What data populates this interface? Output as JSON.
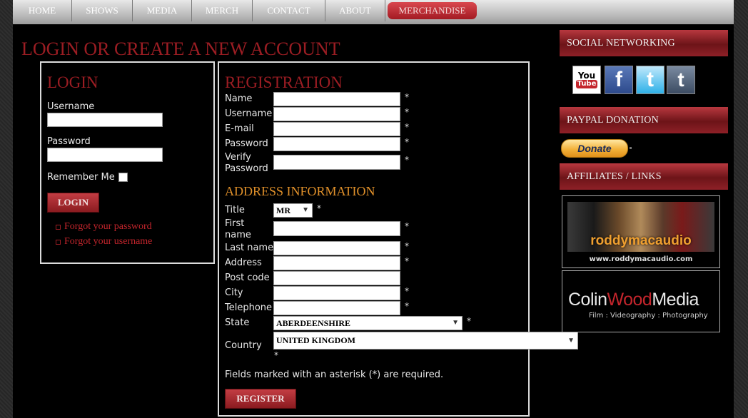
{
  "nav": {
    "items": [
      "HOME",
      "SHOWS",
      "MEDIA",
      "MERCH",
      "CONTACT",
      "ABOUT"
    ],
    "active": "MERCHANDISE"
  },
  "page_title": "LOGIN OR CREATE A NEW ACCOUNT",
  "login": {
    "heading": "LOGIN",
    "username_label": "Username",
    "password_label": "Password",
    "remember_label": "Remember Me",
    "button": "LOGIN",
    "forgot_password": "Forgot your password",
    "forgot_username": "Forgot your username"
  },
  "registration": {
    "heading": "REGISTRATION",
    "name_label": "Name",
    "username_label": "Username",
    "email_label": "E-mail",
    "password_label": "Password",
    "verify_label_1": "Verify",
    "verify_label_2": "Password",
    "required_mark": "*"
  },
  "address": {
    "heading": "ADDRESS INFORMATION",
    "title_label": "Title",
    "title_value": "MR",
    "first_name_label_1": "First",
    "first_name_label_2": "name",
    "last_name_label": "Last name",
    "address_label": "Address",
    "postcode_label": "Post code",
    "city_label": "City",
    "telephone_label": "Telephone",
    "state_label": "State",
    "state_value": "ABERDEENSHIRE",
    "country_label": "Country",
    "country_value": "UNITED KINGDOM",
    "required_note": "Fields marked with an asterisk (*) are required.",
    "register_button": "REGISTER"
  },
  "sidebar": {
    "social_heading": "SOCIAL NETWORKING",
    "social_icons": [
      "youtube-icon",
      "facebook-icon",
      "twitter-icon",
      "tumblr-icon"
    ],
    "youtube_text_1": "You",
    "youtube_text_2": "Tube",
    "facebook_text": "f",
    "twitter_text": "t",
    "tumblr_text": "t",
    "paypal_heading": "PAYPAL DONATION",
    "donate_label": "Donate",
    "affiliates_heading": "AFFILIATES / LINKS",
    "affiliate_1_name": "roddymacaudio",
    "affiliate_1_url": "www.roddymacaudio.com",
    "affiliate_2_name_a": "Colin",
    "affiliate_2_name_b": "Wood",
    "affiliate_2_name_c": "Media",
    "affiliate_2_tagline": "Film : Videography : Photography"
  },
  "colors": {
    "accent_red": "#9b1d23",
    "heading_orange": "#e0902a",
    "link_red": "#c4252c"
  }
}
